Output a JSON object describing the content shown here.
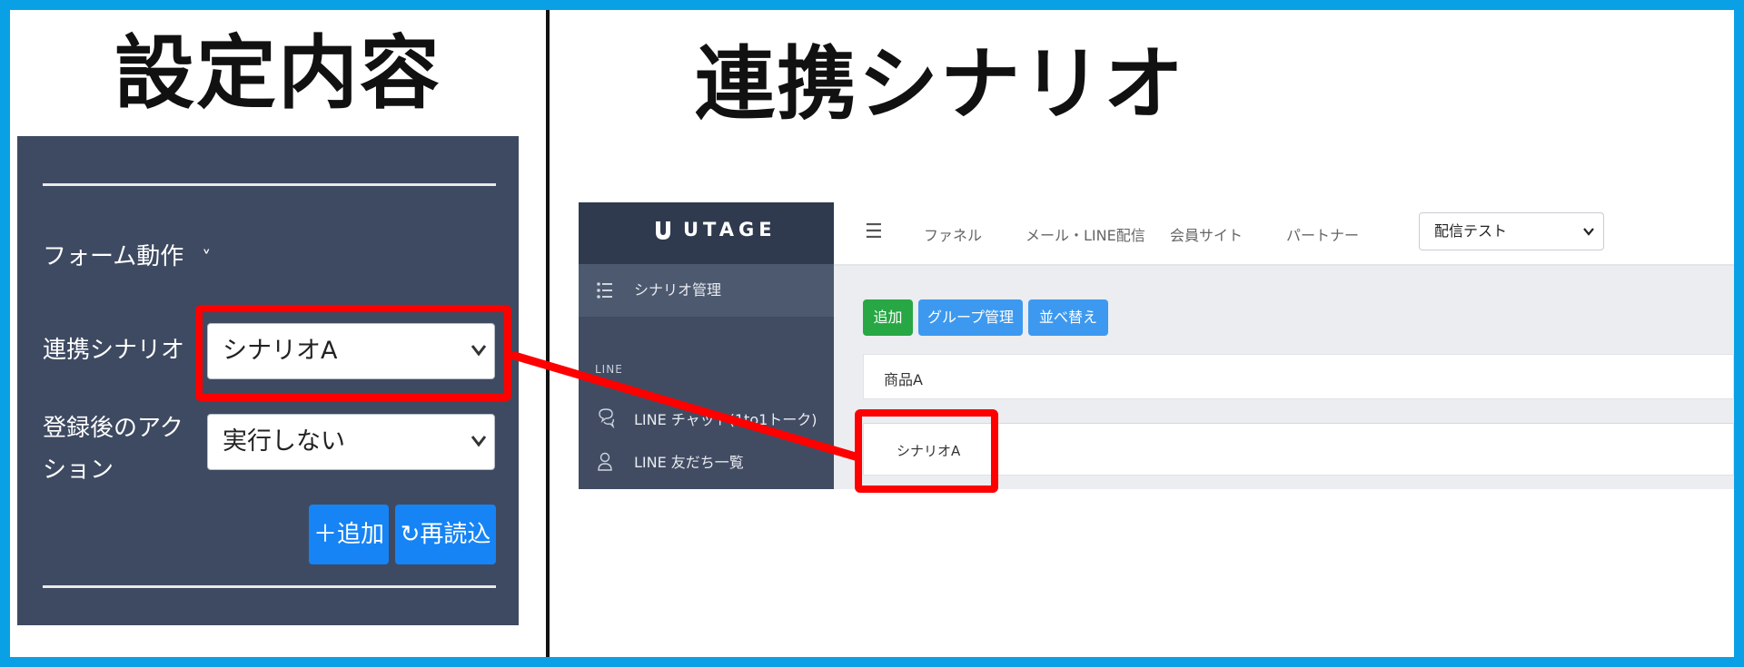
{
  "headings": {
    "left": "設定内容",
    "right": "連携シナリオ"
  },
  "settings": {
    "section_title": "フォーム動作",
    "section_chevron": "˅",
    "scenario_label": "連携シナリオ",
    "scenario_value": "シナリオA",
    "after_label_line1": "登録後のアク",
    "after_label_line2": "ション",
    "after_value": "実行しない",
    "add_button": "＋追加",
    "reload_button": "↻再読込"
  },
  "app": {
    "logo": "UTAGE",
    "sidebar": {
      "active_item": "シナリオ管理",
      "caption": "LINE",
      "item_chat": "LINE チャット(1to1トーク)",
      "item_friends": "LINE 友だち一覧"
    },
    "topbar": {
      "menu_icon": "☰",
      "nav": [
        "ファネル",
        "メール・LINE配信",
        "会員サイト",
        "パートナー"
      ],
      "account_select": "配信テスト"
    },
    "toolbar": {
      "add": "追加",
      "group": "グループ管理",
      "sort": "並べ替え"
    },
    "group_name": "商品A",
    "scenario_item": "シナリオA"
  },
  "colors": {
    "frame": "#0aa0e6",
    "panel": "#3e4a61",
    "highlight": "#ff0000",
    "primary_blue": "#1684f5",
    "green": "#28a745"
  },
  "icons": {
    "select_arrow": "chevron-down-icon",
    "scenario_menu": "list-icon",
    "chat": "chat-icon",
    "friends": "user-icon"
  }
}
